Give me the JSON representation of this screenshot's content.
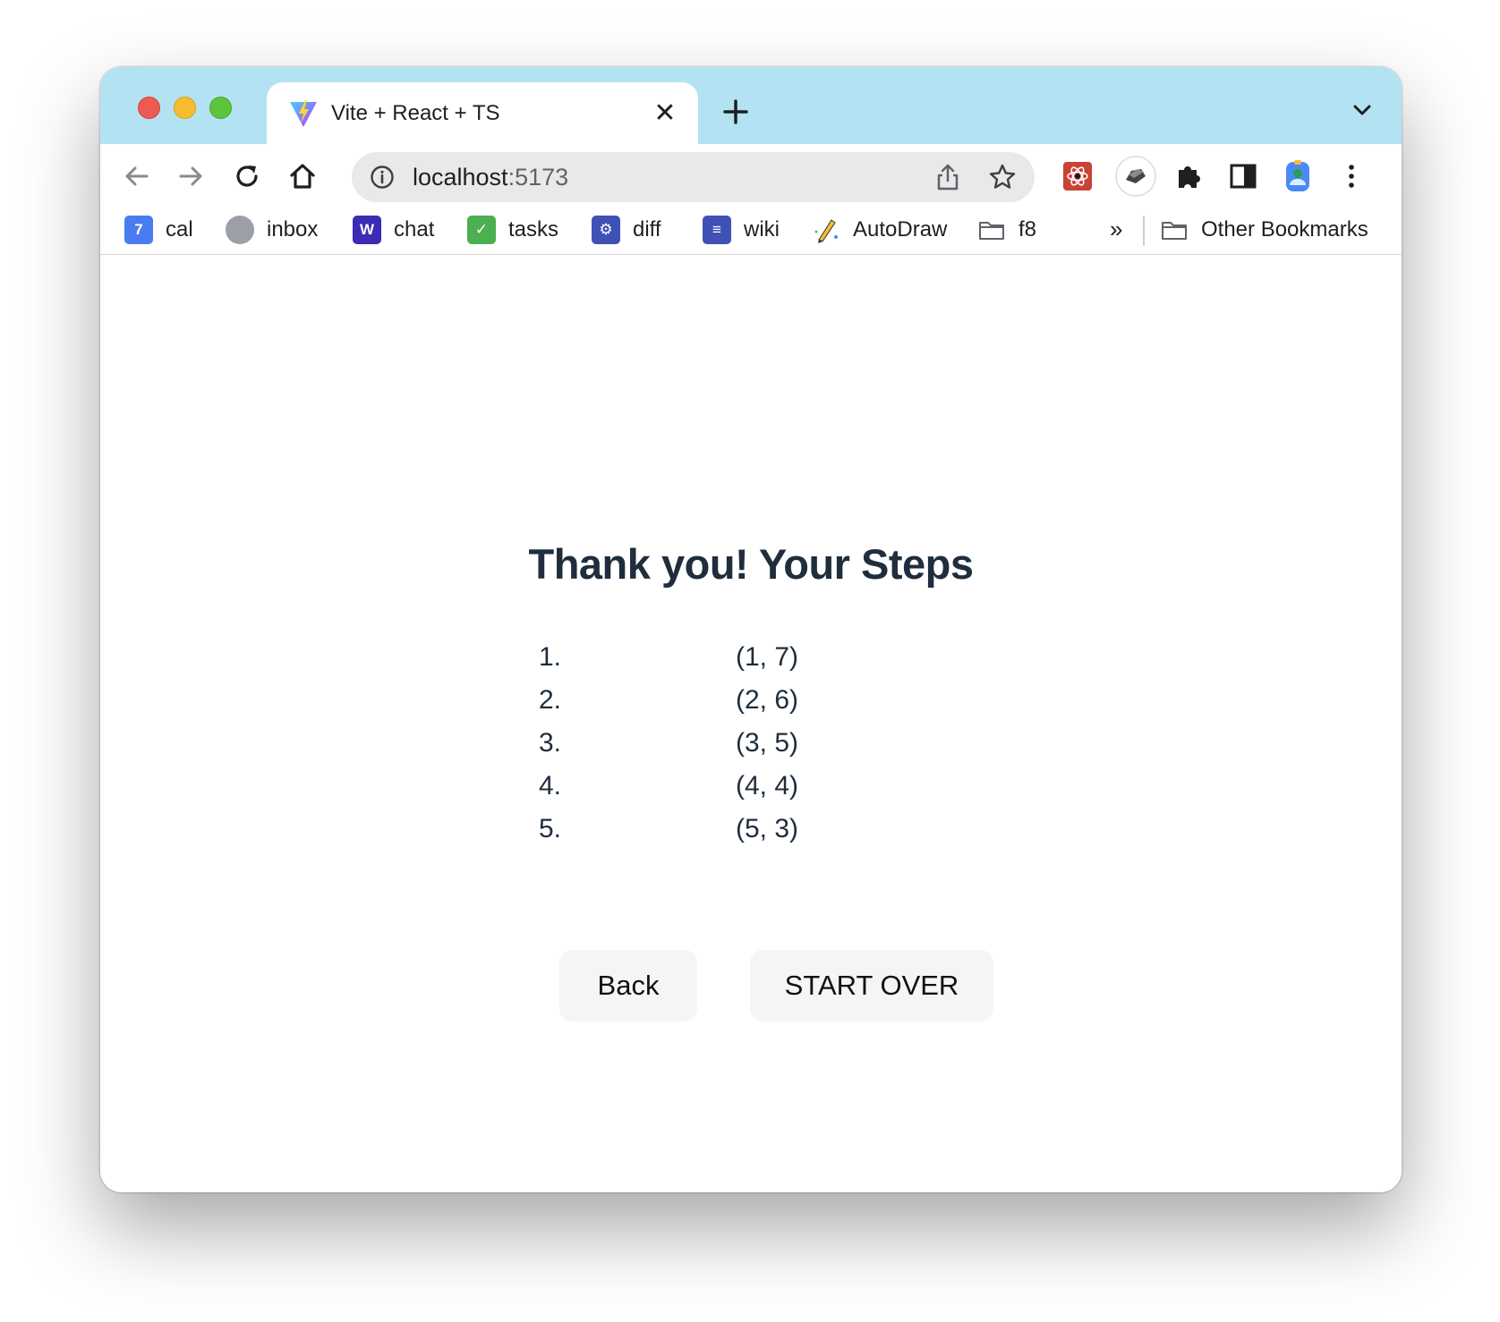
{
  "browser": {
    "tab": {
      "title": "Vite + React + TS"
    },
    "address": {
      "host": "localhost",
      "port": ":5173"
    },
    "bookmarks": [
      {
        "label": "cal",
        "icon": "calendar-icon",
        "color": "#4a7cf0",
        "glyph": "7"
      },
      {
        "label": "inbox",
        "icon": "globe-icon",
        "color": "#9aa0a6",
        "glyph": ""
      },
      {
        "label": "chat",
        "icon": "workplace-chat-icon",
        "color": "#3b2bb5",
        "glyph": "W"
      },
      {
        "label": "tasks",
        "icon": "checkmark-icon",
        "color": "#4caf50",
        "glyph": "✓"
      },
      {
        "label": "diff",
        "icon": "gear-icon",
        "color": "#3f51b5",
        "glyph": "⚙"
      },
      {
        "label": "wiki",
        "icon": "document-icon",
        "color": "#3f51b5",
        "glyph": "≡"
      },
      {
        "label": "AutoDraw",
        "icon": "autodraw-icon",
        "color": "#ffffff",
        "glyph": ""
      },
      {
        "label": "f8",
        "icon": "folder-icon",
        "color": "#ffffff",
        "glyph": ""
      }
    ],
    "more_label": "»",
    "other_bookmarks": "Other Bookmarks"
  },
  "page": {
    "heading": "Thank you! Your Steps",
    "steps": [
      {
        "num": "1.",
        "coord": "(1, 7)"
      },
      {
        "num": "2.",
        "coord": "(2, 6)"
      },
      {
        "num": "3.",
        "coord": "(3, 5)"
      },
      {
        "num": "4.",
        "coord": "(4, 4)"
      },
      {
        "num": "5.",
        "coord": "(5, 3)"
      }
    ],
    "back_label": "Back",
    "start_over_label": "START OVER"
  }
}
